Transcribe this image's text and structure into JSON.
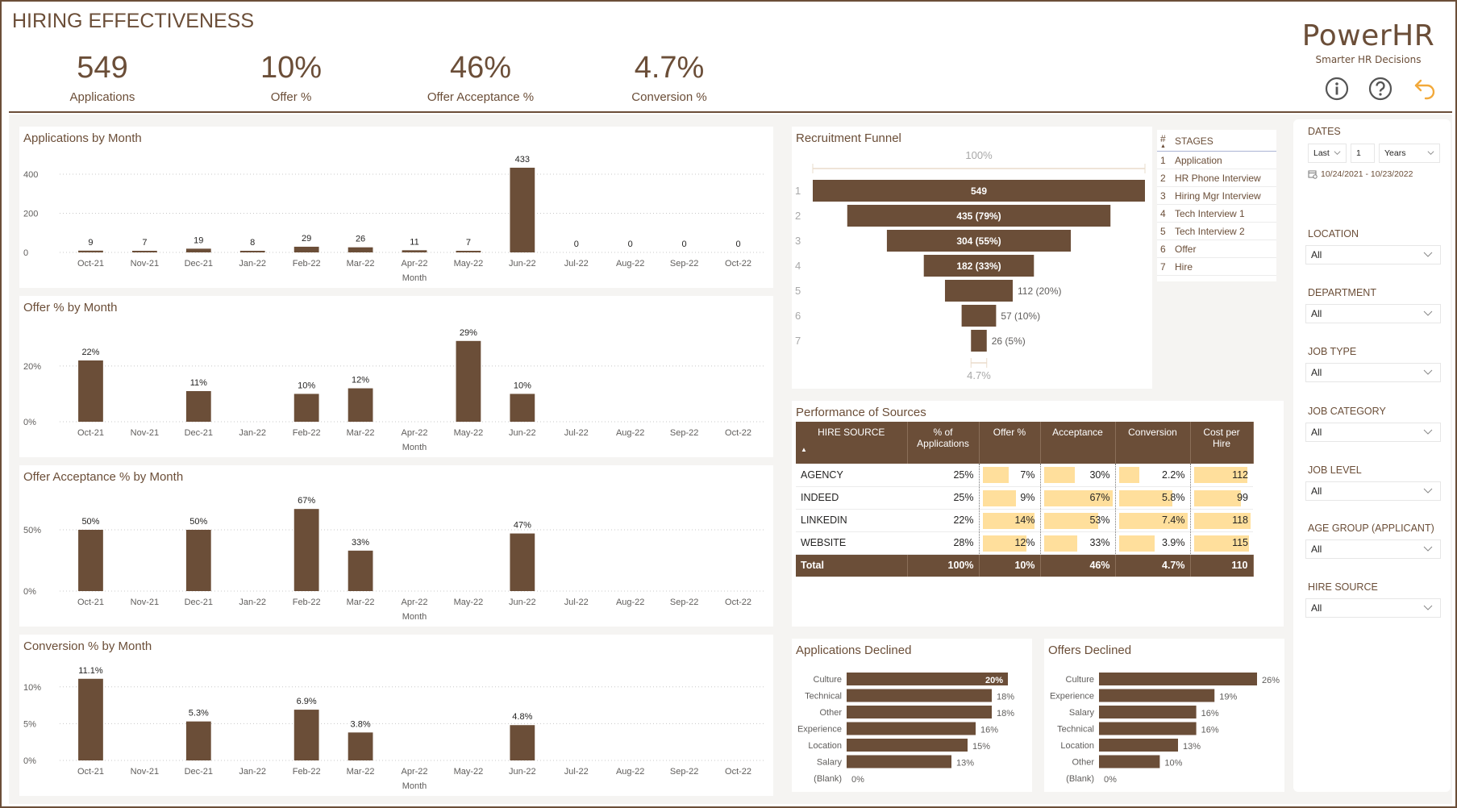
{
  "header": {
    "title": "HIRING EFFECTIVENESS",
    "kpis": [
      {
        "value": "549",
        "label": "Applications"
      },
      {
        "value": "10%",
        "label": "Offer %"
      },
      {
        "value": "46%",
        "label": "Offer Acceptance %"
      },
      {
        "value": "4.7%",
        "label": "Conversion %"
      }
    ],
    "brand": {
      "name": "PowerHR",
      "tagline": "Smarter HR Decisions"
    },
    "icons": [
      "info-icon",
      "help-icon",
      "back-arrow-icon"
    ]
  },
  "colors": {
    "brand_brown": "#6b4e38",
    "bar_highlight": "#ffdf9c",
    "back_arrow": "#f2a93b",
    "canvas_bg": "#f5f4f2"
  },
  "chart_data": [
    {
      "id": "applications_by_month",
      "type": "bar",
      "title": "Applications by Month",
      "xlabel": "Month",
      "ylabel": "",
      "categories": [
        "Oct-21",
        "Nov-21",
        "Dec-21",
        "Jan-22",
        "Feb-22",
        "Mar-22",
        "Apr-22",
        "May-22",
        "Jun-22",
        "Jul-22",
        "Aug-22",
        "Sep-22",
        "Oct-22"
      ],
      "values": [
        9,
        7,
        19,
        8,
        29,
        26,
        11,
        7,
        433,
        0,
        0,
        0,
        0
      ],
      "data_labels": [
        "9",
        "7",
        "19",
        "8",
        "29",
        "26",
        "11",
        "7",
        "433",
        "0",
        "0",
        "0",
        "0"
      ],
      "yticks": [
        0,
        200,
        400
      ],
      "ytick_labels": [
        "0",
        "200",
        "400"
      ],
      "ylim": [
        0,
        470
      ],
      "grid": true
    },
    {
      "id": "offer_pct_by_month",
      "type": "bar",
      "title": "Offer % by Month",
      "xlabel": "Month",
      "ylabel": "",
      "categories": [
        "Oct-21",
        "Nov-21",
        "Dec-21",
        "Jan-22",
        "Feb-22",
        "Mar-22",
        "Apr-22",
        "May-22",
        "Jun-22",
        "Jul-22",
        "Aug-22",
        "Sep-22",
        "Oct-22"
      ],
      "values": [
        22,
        null,
        11,
        null,
        10,
        12,
        null,
        29,
        10,
        null,
        null,
        null,
        null
      ],
      "data_labels": [
        "22%",
        "",
        "11%",
        "",
        "10%",
        "12%",
        "",
        "29%",
        "10%",
        "",
        "",
        "",
        ""
      ],
      "yticks": [
        0,
        20
      ],
      "ytick_labels": [
        "0%",
        "20%"
      ],
      "ylim": [
        0,
        33
      ],
      "grid": true
    },
    {
      "id": "offer_acceptance_by_month",
      "type": "bar",
      "title": "Offer Acceptance % by Month",
      "xlabel": "Month",
      "ylabel": "",
      "categories": [
        "Oct-21",
        "Nov-21",
        "Dec-21",
        "Jan-22",
        "Feb-22",
        "Mar-22",
        "Apr-22",
        "May-22",
        "Jun-22",
        "Jul-22",
        "Aug-22",
        "Sep-22",
        "Oct-22"
      ],
      "values": [
        50,
        null,
        50,
        null,
        67,
        33,
        null,
        null,
        47,
        null,
        null,
        null,
        null
      ],
      "data_labels": [
        "50%",
        "",
        "50%",
        "",
        "67%",
        "33%",
        "",
        "",
        "47%",
        "",
        "",
        "",
        ""
      ],
      "yticks": [
        0,
        50
      ],
      "ytick_labels": [
        "0%",
        "50%"
      ],
      "ylim": [
        0,
        75
      ],
      "grid": true
    },
    {
      "id": "conversion_by_month",
      "type": "bar",
      "title": "Conversion % by Month",
      "xlabel": "Month",
      "ylabel": "",
      "categories": [
        "Oct-21",
        "Nov-21",
        "Dec-21",
        "Jan-22",
        "Feb-22",
        "Mar-22",
        "Apr-22",
        "May-22",
        "Jun-22",
        "Jul-22",
        "Aug-22",
        "Sep-22",
        "Oct-22"
      ],
      "values": [
        11.1,
        null,
        5.3,
        null,
        6.9,
        3.8,
        null,
        null,
        4.8,
        null,
        null,
        null,
        null
      ],
      "data_labels": [
        "11.1%",
        "",
        "5.3%",
        "",
        "6.9%",
        "3.8%",
        "",
        "",
        "4.8%",
        "",
        "",
        "",
        ""
      ],
      "yticks": [
        0,
        5,
        10
      ],
      "ytick_labels": [
        "0%",
        "5%",
        "10%"
      ],
      "ylim": [
        0,
        12.5
      ],
      "grid": true
    },
    {
      "id": "recruitment_funnel",
      "type": "bar",
      "title": "Recruitment Funnel",
      "categories": [
        "1",
        "2",
        "3",
        "4",
        "5",
        "6",
        "7"
      ],
      "values": [
        549,
        435,
        304,
        182,
        112,
        57,
        26
      ],
      "data_labels": [
        "549",
        "435 (79%)",
        "304 (55%)",
        "182 (33%)",
        "112 (20%)",
        "57 (10%)",
        "26 (5%)"
      ],
      "top_label": "100%",
      "bottom_label": "4.7%"
    },
    {
      "id": "applications_declined",
      "type": "bar",
      "orientation": "horizontal",
      "title": "Applications Declined",
      "categories": [
        "Culture",
        "Technical",
        "Other",
        "Experience",
        "Location",
        "Salary",
        "(Blank)"
      ],
      "values": [
        20,
        18,
        18,
        16,
        15,
        13,
        0
      ],
      "data_labels": [
        "20%",
        "18%",
        "18%",
        "16%",
        "15%",
        "13%",
        "0%"
      ],
      "xlim": [
        0,
        20
      ]
    },
    {
      "id": "offers_declined",
      "type": "bar",
      "orientation": "horizontal",
      "title": "Offers Declined",
      "categories": [
        "Culture",
        "Experience",
        "Salary",
        "Technical",
        "Location",
        "Other",
        "(Blank)"
      ],
      "values": [
        26,
        19,
        16,
        16,
        13,
        10,
        0
      ],
      "data_labels": [
        "26%",
        "19%",
        "16%",
        "16%",
        "13%",
        "10%",
        "0%"
      ],
      "xlim": [
        0,
        26
      ]
    }
  ],
  "stages": {
    "headers": [
      "#",
      "STAGES"
    ],
    "rows": [
      {
        "num": "1",
        "name": "Application"
      },
      {
        "num": "2",
        "name": "HR Phone Interview"
      },
      {
        "num": "3",
        "name": "Hiring Mgr Interview"
      },
      {
        "num": "4",
        "name": "Tech Interview 1"
      },
      {
        "num": "5",
        "name": "Tech Interview 2"
      },
      {
        "num": "6",
        "name": "Offer"
      },
      {
        "num": "7",
        "name": "Hire"
      }
    ]
  },
  "performance": {
    "title": "Performance of Sources",
    "headers": [
      "HIRE SOURCE",
      "% of Applications",
      "Offer %",
      "Acceptance",
      "Conversion",
      "Cost per Hire"
    ],
    "rows": [
      {
        "source": "AGENCY",
        "pct_apps": "25%",
        "offer": "7%",
        "offer_v": 7,
        "accept": "30%",
        "accept_v": 30,
        "conv": "2.2%",
        "conv_v": 2.2,
        "cost": "112",
        "cost_v": 112
      },
      {
        "source": "INDEED",
        "pct_apps": "25%",
        "offer": "9%",
        "offer_v": 9,
        "accept": "67%",
        "accept_v": 67,
        "conv": "5.8%",
        "conv_v": 5.8,
        "cost": "99",
        "cost_v": 99
      },
      {
        "source": "LINKEDIN",
        "pct_apps": "22%",
        "offer": "14%",
        "offer_v": 14,
        "accept": "53%",
        "accept_v": 53,
        "conv": "7.4%",
        "conv_v": 7.4,
        "cost": "118",
        "cost_v": 118
      },
      {
        "source": "WEBSITE",
        "pct_apps": "28%",
        "offer": "12%",
        "offer_v": 12,
        "accept": "33%",
        "accept_v": 33,
        "conv": "3.9%",
        "conv_v": 3.9,
        "cost": "115",
        "cost_v": 115
      }
    ],
    "total": {
      "source": "Total",
      "pct_apps": "100%",
      "offer": "10%",
      "accept": "46%",
      "conv": "4.7%",
      "cost": "110"
    }
  },
  "filters": {
    "dates": {
      "label": "DATES",
      "mode": "Last",
      "count": "1",
      "unit": "Years",
      "range": "10/24/2021 - 10/23/2022"
    },
    "dropdowns": [
      {
        "label": "LOCATION",
        "value": "All"
      },
      {
        "label": "DEPARTMENT",
        "value": "All"
      },
      {
        "label": "JOB TYPE",
        "value": "All"
      },
      {
        "label": "JOB CATEGORY",
        "value": "All"
      },
      {
        "label": "JOB LEVEL",
        "value": "All"
      },
      {
        "label": "AGE GROUP (APPLICANT)",
        "value": "All"
      },
      {
        "label": "HIRE SOURCE",
        "value": "All"
      }
    ]
  }
}
